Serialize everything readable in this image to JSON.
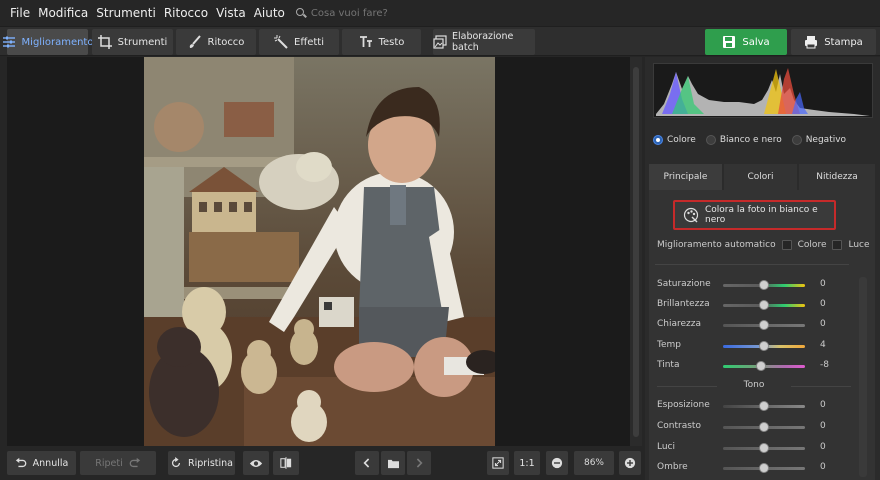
{
  "menubar": {
    "items": [
      "File",
      "Modifica",
      "Strumenti",
      "Ritocco",
      "Vista",
      "Aiuto"
    ],
    "search_placeholder": "Cosa vuoi fare?"
  },
  "toolbar": {
    "tabs": [
      {
        "label": "Miglioramento",
        "icon": "sliders-icon",
        "active": true
      },
      {
        "label": "Strumenti",
        "icon": "crop-icon",
        "active": false
      },
      {
        "label": "Ritocco",
        "icon": "brush-icon",
        "active": false
      },
      {
        "label": "Effetti",
        "icon": "magic-wand-icon",
        "active": false
      },
      {
        "label": "Testo",
        "icon": "text-icon",
        "active": false
      }
    ],
    "batch_label": "Elaborazione batch",
    "save_label": "Salva",
    "print_label": "Stampa"
  },
  "panel": {
    "color_modes": [
      {
        "label": "Colore",
        "selected": true
      },
      {
        "label": "Bianco e nero",
        "selected": false
      },
      {
        "label": "Negativo",
        "selected": false
      }
    ],
    "tabs": [
      {
        "label": "Principale",
        "active": true
      },
      {
        "label": "Colori",
        "active": false
      },
      {
        "label": "Nitidezza",
        "active": false
      }
    ],
    "colorize_label": "Colora la foto in bianco e nero",
    "auto_label": "Miglioramento automatico",
    "auto_color_label": "Colore",
    "auto_light_label": "Luce",
    "sliders": [
      {
        "label": "Saturazione",
        "value": "0",
        "position": 0.5
      },
      {
        "label": "Brillantezza",
        "value": "0",
        "position": 0.5
      },
      {
        "label": "Chiarezza",
        "value": "0",
        "position": 0.5
      },
      {
        "label": "Temp",
        "value": "4",
        "position": 0.5
      },
      {
        "label": "Tinta",
        "value": "-8",
        "position": 0.46
      }
    ],
    "tone_header": "Tono",
    "tone_sliders": [
      {
        "label": "Esposizione",
        "value": "0",
        "position": 0.5
      },
      {
        "label": "Contrasto",
        "value": "0",
        "position": 0.5
      },
      {
        "label": "Luci",
        "value": "0",
        "position": 0.5
      },
      {
        "label": "Ombre",
        "value": "0",
        "position": 0.5
      }
    ]
  },
  "bottom": {
    "undo_label": "Annulla",
    "redo_label": "Ripeti",
    "reset_label": "Ripristina",
    "ratio_label": "1:1",
    "zoom_value": "86%"
  },
  "colors": {
    "accent": "#2f9e4d",
    "highlight": "#c62a2a",
    "active_tab_text": "#7fb2ff",
    "radio_on": "#2d64b4"
  }
}
